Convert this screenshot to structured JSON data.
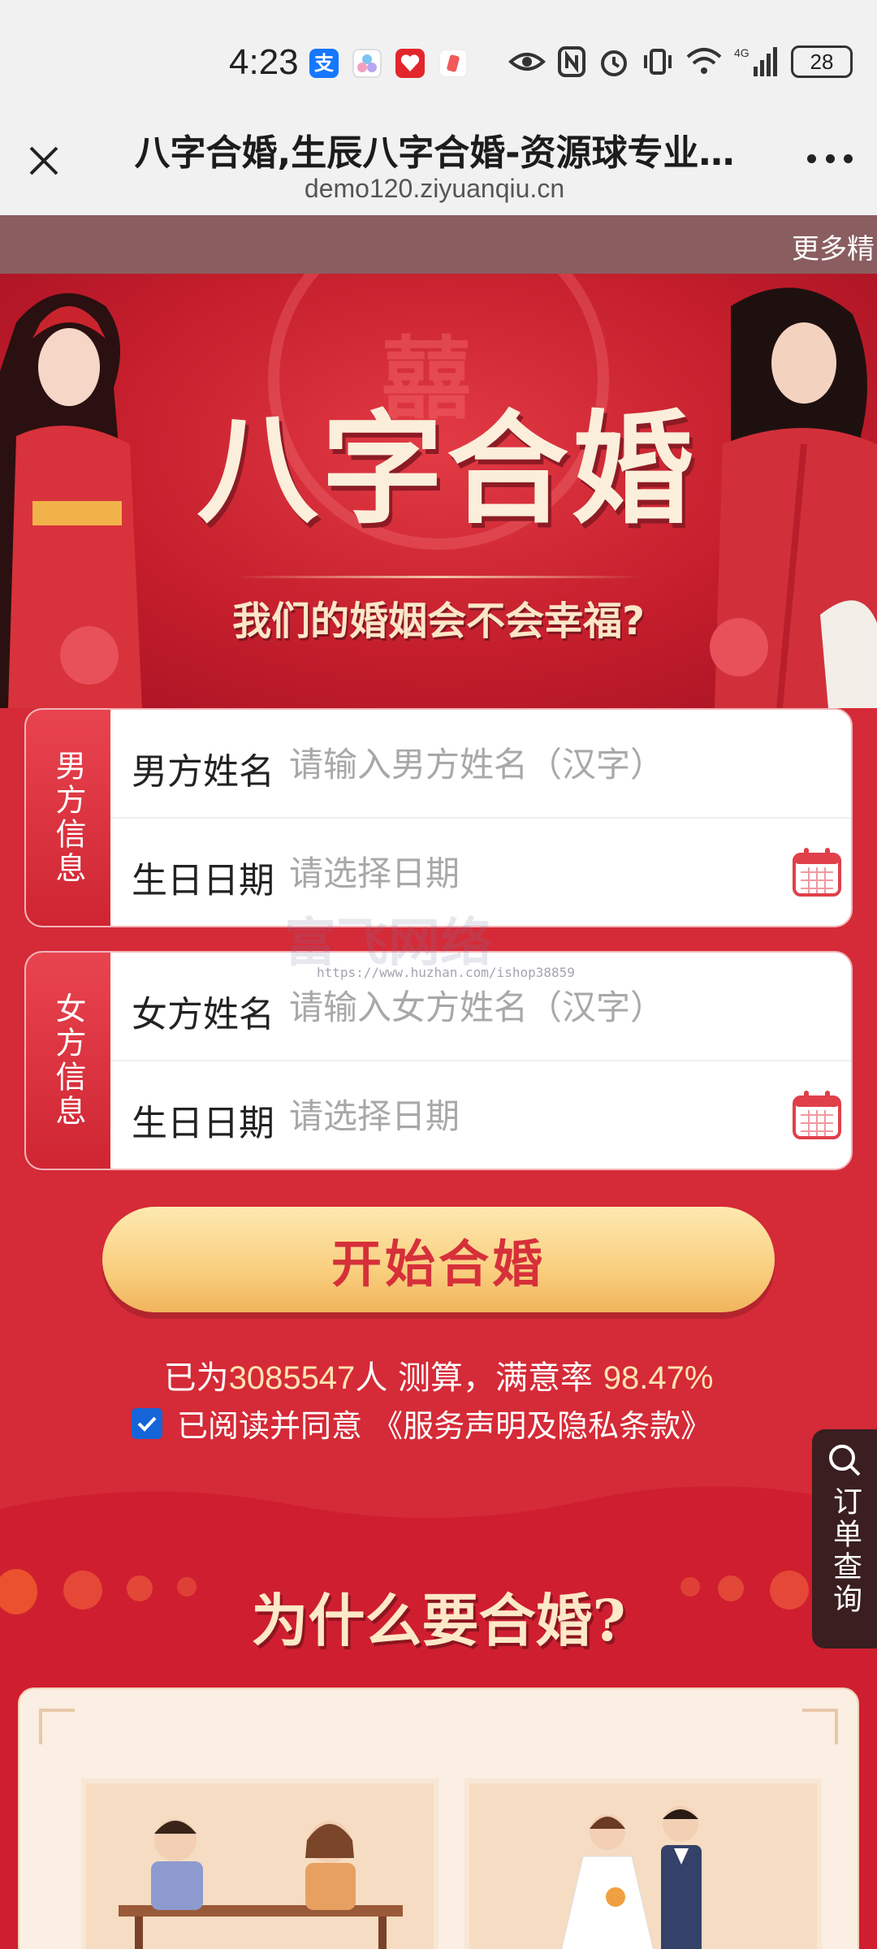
{
  "status_bar": {
    "time": "4:23",
    "network": "4G",
    "battery": "28",
    "app_icons": [
      {
        "name": "alipay-icon",
        "glyph": "支",
        "color": "#1677ff"
      },
      {
        "name": "app-icon-2",
        "glyph": "",
        "color": "#7ec3f0"
      },
      {
        "name": "app-icon-3",
        "glyph": "",
        "color": "#e3262d"
      },
      {
        "name": "app-icon-4",
        "glyph": "",
        "color": "#f05a5a"
      }
    ]
  },
  "browser": {
    "title": "八字合婚,生辰八字合婚-资源球专业…",
    "url": "demo120.ziyuanqiu.cn"
  },
  "ticker": {
    "text": "更多精"
  },
  "banner": {
    "title": "八字合婚",
    "subtitle": "我们的婚姻会不会幸福?"
  },
  "male_card": {
    "side_label": "男方信息",
    "name_label": "男方姓名",
    "name_placeholder": "请输入男方姓名（汉字）",
    "date_label": "生日日期",
    "date_placeholder": "请选择日期"
  },
  "female_card": {
    "side_label": "女方信息",
    "name_label": "女方姓名",
    "name_placeholder": "请输入女方姓名（汉字）",
    "date_label": "生日日期",
    "date_placeholder": "请选择日期"
  },
  "watermark": {
    "text": "富飞网络",
    "url": "https://www.huzhan.com/ishop38859"
  },
  "start_button": {
    "label": "开始合婚"
  },
  "stats": {
    "prefix": "已为",
    "count": "3085547",
    "middle": "人 测算，满意率 ",
    "rate": "98.47%"
  },
  "agreement": {
    "checked": true,
    "text": "已阅读并同意 《服务声明及隐私条款》"
  },
  "order_query": {
    "label": "订单查询"
  },
  "why_section": {
    "title": "为什么要合婚?"
  },
  "colors": {
    "primary_red": "#d52a37",
    "button_gold": "#f9cf7f",
    "checkbox_blue": "#1565d8"
  }
}
